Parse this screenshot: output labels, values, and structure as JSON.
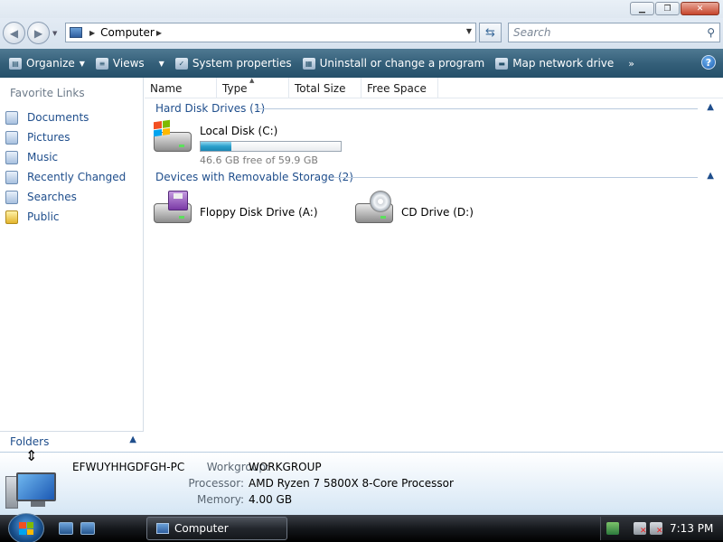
{
  "window": {
    "minimize_label": "▁",
    "maximize_label": "❐",
    "close_label": "✕"
  },
  "address": {
    "location": "Computer",
    "search_placeholder": "Search"
  },
  "toolbar": {
    "organize": "Organize",
    "views": "Views",
    "system_properties": "System properties",
    "uninstall": "Uninstall or change a program",
    "map_network_drive": "Map network drive",
    "more": "»",
    "help": "?"
  },
  "nav": {
    "favorite_links_title": "Favorite Links",
    "items": [
      {
        "label": "Documents",
        "icon": "documents-icon"
      },
      {
        "label": "Pictures",
        "icon": "pictures-icon"
      },
      {
        "label": "Music",
        "icon": "music-icon"
      },
      {
        "label": "Recently Changed",
        "icon": "recently-changed-icon"
      },
      {
        "label": "Searches",
        "icon": "searches-icon"
      },
      {
        "label": "Public",
        "icon": "public-folder-icon"
      }
    ],
    "folders_label": "Folders"
  },
  "columns": [
    "Name",
    "Type",
    "Total Size",
    "Free Space"
  ],
  "groups": {
    "hard_disk": {
      "title": "Hard Disk Drives (1)",
      "drives": [
        {
          "name": "Local Disk (C:)",
          "free_text": "46.6 GB free of 59.9 GB",
          "used_fraction": 0.22
        }
      ]
    },
    "removable": {
      "title": "Devices with Removable Storage (2)",
      "drives": [
        {
          "name": "Floppy Disk Drive (A:)"
        },
        {
          "name": "CD Drive (D:)"
        }
      ]
    }
  },
  "details": {
    "computer_name": "EFWUYHHGDFGH-PC",
    "workgroup_label": "Workgroup:",
    "workgroup_value": "WORKGROUP",
    "processor_label": "Processor:",
    "processor_value": "AMD Ryzen 7 5800X 8-Core Processor",
    "memory_label": "Memory:",
    "memory_value": "4.00 GB"
  },
  "taskbar": {
    "task_label": "Computer",
    "clock": "7:13 PM"
  },
  "colors": {
    "link_blue": "#1f4e8c",
    "toolbar_bg": "#35607a",
    "usage_fill": "#2aa0cc"
  }
}
